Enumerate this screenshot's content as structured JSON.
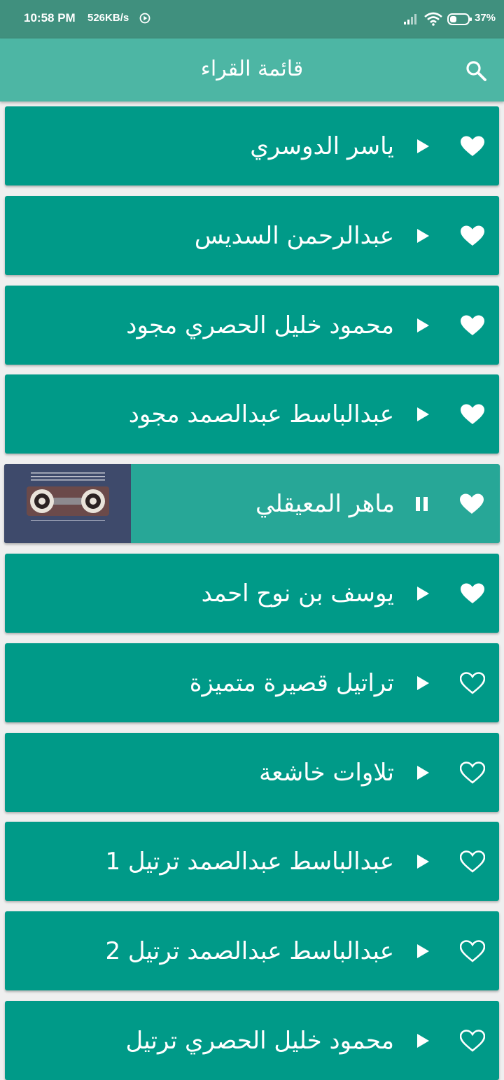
{
  "status_bar": {
    "time": "10:58 PM",
    "speed": "526KB/s",
    "battery": "37",
    "icons": [
      "play-status-icon",
      "signal-icon",
      "wifi-icon",
      "battery-icon"
    ]
  },
  "app_bar": {
    "title": "قائمة القراء",
    "search_icon": "search-icon"
  },
  "colors": {
    "status_bar": "#40907e",
    "app_bar": "#4db6a4",
    "card": "#009a88",
    "card_active": "#27a797",
    "background": "#efefef"
  },
  "reciters": [
    {
      "name": "ياسر الدوسري",
      "favorite": true,
      "state": "play"
    },
    {
      "name": "عبدالرحمن السديس",
      "favorite": true,
      "state": "play"
    },
    {
      "name": "محمود خليل الحصري مجود",
      "favorite": true,
      "state": "play"
    },
    {
      "name": "عبدالباسط عبدالصمد مجود",
      "favorite": true,
      "state": "play"
    },
    {
      "name": "ماهر المعيقلي",
      "favorite": true,
      "state": "pause",
      "has_thumbnail": true
    },
    {
      "name": "يوسف بن نوح احمد",
      "favorite": true,
      "state": "play"
    },
    {
      "name": "تراتيل قصيرة متميزة",
      "favorite": false,
      "state": "play"
    },
    {
      "name": "تلاوات خاشعة",
      "favorite": false,
      "state": "play"
    },
    {
      "name": "عبدالباسط عبدالصمد ترتيل 1",
      "favorite": false,
      "state": "play"
    },
    {
      "name": "عبدالباسط عبدالصمد ترتيل 2",
      "favorite": false,
      "state": "play"
    },
    {
      "name": "محمود خليل الحصري ترتيل",
      "favorite": false,
      "state": "play"
    }
  ]
}
